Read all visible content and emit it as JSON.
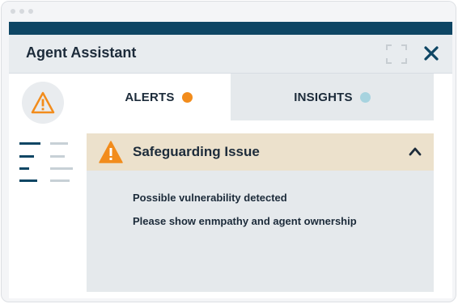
{
  "panel": {
    "title": "Agent Assistant"
  },
  "tabs": [
    {
      "label": "ALERTS",
      "status_color": "#f28c1c",
      "active": true
    },
    {
      "label": "INSIGHTS",
      "status_color": "#a7d3df",
      "active": false
    }
  ],
  "alert": {
    "title": "Safeguarding Issue",
    "expanded": true,
    "lines": [
      "Possible vulnerability detected",
      "Please show enmpathy and agent ownership"
    ]
  },
  "colors": {
    "accent": "#0e4664",
    "warning": "#f28c1c",
    "alert_header_bg": "#ece1cc"
  },
  "icons": {
    "rail_alert": "warning-triangle-icon",
    "rail_list": "list-view-icon",
    "expand": "expand-icon",
    "close": "close-icon",
    "collapse": "chevron-up-icon"
  }
}
